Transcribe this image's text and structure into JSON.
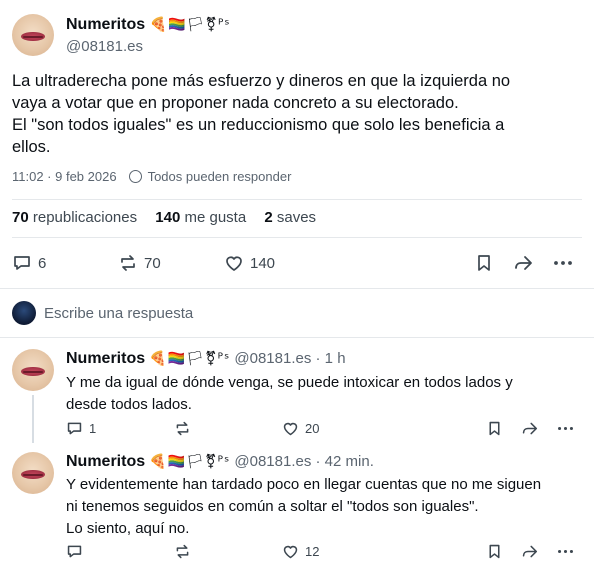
{
  "post": {
    "author_name": "Numeritos",
    "author_badges": "🍕🏳️‍🌈🏳⚧ᴾˢ",
    "handle": "@08181.es",
    "text_lines": [
      "La ultraderecha pone más esfuerzo y dineros en que la izquierda no",
      "vaya a votar que en proponer nada concreto a su electorado.",
      "El \"son todos iguales\" es un reduccionismo que solo les beneficia a",
      "ellos."
    ],
    "time": "11:02 · 9 feb 2026",
    "reply_setting": "Todos pueden responder",
    "stats": {
      "reposts_count": "70",
      "reposts_label": "republicaciones",
      "likes_count": "140",
      "likes_label": "me gusta",
      "saves_count": "2",
      "saves_label": "saves"
    },
    "actions": {
      "replies": "6",
      "reposts": "70",
      "likes": "140"
    }
  },
  "compose": {
    "placeholder": "Escribe una respuesta"
  },
  "replies": [
    {
      "author_name": "Numeritos",
      "author_badges": "🍕🏳️‍🌈🏳⚧ᴾˢ",
      "handle": "@08181.es",
      "age": "· 1 h",
      "text_lines": [
        "Y me da igual de dónde venga, se puede intoxicar en todos lados y",
        "desde todos lados."
      ],
      "replies": "1",
      "reposts": "",
      "likes": "20"
    },
    {
      "author_name": "Numeritos",
      "author_badges": "🍕🏳️‍🌈🏳⚧ᴾˢ",
      "handle": "@08181.es",
      "age": "· 42 min.",
      "text_lines": [
        "Y evidentemente han tardado poco en llegar cuentas que no me siguen",
        "ni tenemos seguidos en común a soltar el \"todos son iguales\".",
        "Lo siento, aquí no."
      ],
      "replies": "",
      "reposts": "",
      "likes": "12"
    }
  ]
}
